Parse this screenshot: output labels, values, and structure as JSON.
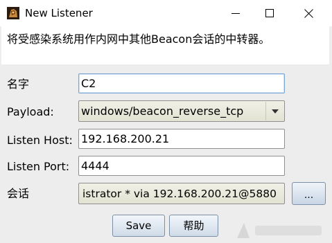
{
  "window": {
    "title": "New Listener",
    "icon": "cobalt-strike-app-icon",
    "controls": {
      "minimize": "minimize-icon",
      "maximize": "maximize-icon",
      "close": "close-icon"
    }
  },
  "description": "将受感染系统用作内网中其他Beacon会话的中转器。",
  "form": {
    "name": {
      "label": "名字",
      "value": "C2"
    },
    "payload": {
      "label": "Payload:",
      "value": "windows/beacon_reverse_tcp"
    },
    "listen_host": {
      "label": "Listen Host:",
      "value": "192.168.200.21"
    },
    "listen_port": {
      "label": "Listen Port:",
      "value": "4444"
    },
    "session": {
      "label": "会话",
      "value": "istrator * via  192.168.200.21@5880",
      "browse_label": "..."
    }
  },
  "buttons": {
    "save": "Save",
    "help": "帮助"
  }
}
